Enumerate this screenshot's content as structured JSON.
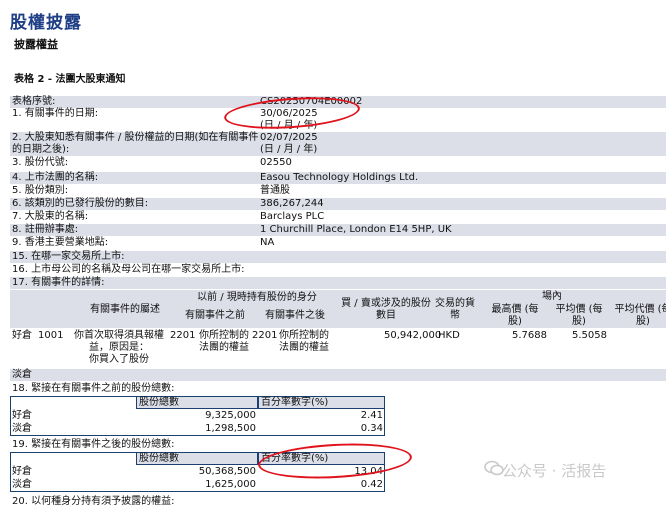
{
  "header": {
    "title": "股權披露",
    "subtitle": "披露權益"
  },
  "form_title": "表格 2 - 法團大股東通知",
  "fields": [
    {
      "label": "表格序號:",
      "value": "CS20250704E00002"
    },
    {
      "label": "1. 有關事件的日期:",
      "value": "30/06/2025"
    },
    {
      "label": "",
      "value": "(日 / 月 / 年)"
    },
    {
      "label": "2. 大股東知悉有關事件 / 股份權益的日期(如在有關事件",
      "value": "02/07/2025"
    },
    {
      "label": "的日期之後):",
      "value": "(日 / 月 / 年)"
    },
    {
      "label": "3. 股份代號:",
      "value": "02550"
    },
    {
      "label": "4. 上市法團的名稱:",
      "value": "Easou Technology Holdings Ltd."
    },
    {
      "label": "5. 股份類別:",
      "value": "普通股"
    },
    {
      "label": "6. 該類別的已發行股份的數目:",
      "value": "386,267,244"
    },
    {
      "label": "7. 大股東的名稱:",
      "value": "Barclays PLC"
    },
    {
      "label": "8. 註冊辦事處:",
      "value": "1 Churchill Place, London E14 5HP, UK"
    },
    {
      "label": "9. 香港主要營業地點:",
      "value": "NA"
    },
    {
      "label": "15. 在哪一家交易所上市:",
      "value": ""
    },
    {
      "label": "16. 上市母公司的名稱及母公司在哪一家交易所上市:",
      "value": ""
    },
    {
      "label": "17. 有關事件的詳情:",
      "value": ""
    }
  ],
  "details": {
    "headers": {
      "event_desc": "有關事件的屬述",
      "capacity_group": "以前 / 現時持有股份的身分",
      "before": "有關事件之前",
      "after": "有關事件之後",
      "shares": [
        "買 / 賣或涉及的股份",
        "數目"
      ],
      "currency": [
        "交易的貨",
        "幣"
      ],
      "onex_group": "場內",
      "high": [
        "最高價 (每",
        "股)"
      ],
      "avg": [
        "平均價 (每",
        "股)"
      ],
      "avg_consideration": [
        "平均代價 (每",
        "股)"
      ]
    },
    "row": {
      "position": "好倉",
      "code": "1001",
      "desc": [
        "你首次取得須具報權",
        "益，原因是：",
        "你買入了股份"
      ],
      "before_code": "2201",
      "before_desc": [
        "你所控制的",
        "法團的權益"
      ],
      "after_code": "2201",
      "after_desc": [
        "你所控制的",
        "法團的權益"
      ],
      "shares": "50,942,000",
      "currency": "HKD",
      "high": "5.7688",
      "avg": "5.5058"
    },
    "short_label": "淡倉"
  },
  "table18": {
    "title": "18. 緊接在有關事件之前的股份總數:",
    "col_shares": "股份總數",
    "col_pct": "百分率數字(%)",
    "rows": [
      {
        "label": "好倉",
        "shares": "9,325,000",
        "pct": "2.41"
      },
      {
        "label": "淡倉",
        "shares": "1,298,500",
        "pct": "0.34"
      }
    ]
  },
  "table19": {
    "title": "19. 緊接在有關事件之後的股份總數:",
    "col_shares": "股份總數",
    "col_pct": "百分率數字(%)",
    "rows": [
      {
        "label": "好倉",
        "shares": "50,368,500",
        "pct": "13.04"
      },
      {
        "label": "淡倉",
        "shares": "1,625,000",
        "pct": "0.42"
      }
    ]
  },
  "truncated_line": "20. 以何種身分持有須予披露的權益:",
  "watermark": "公众号 · 活报告",
  "colors": {
    "title_blue": "#1f3f86",
    "row_shade": "#dcdee8",
    "annotation_red": "#e0121b",
    "border": "#1b3f6e"
  }
}
